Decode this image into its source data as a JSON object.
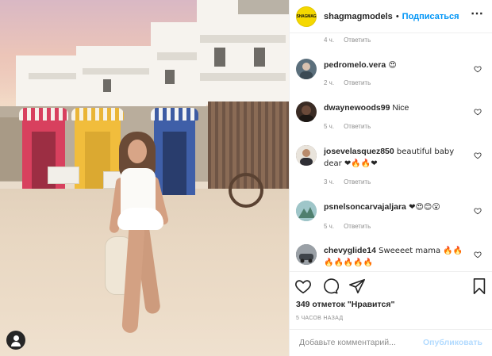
{
  "post": {
    "author": {
      "username": "shagmagmodels",
      "avatar_text": "SHAGMAG",
      "follow_label": "Подписаться",
      "separator": "•"
    },
    "image_alt": "beach photo",
    "top_meta": {
      "time": "4 ч.",
      "reply_label": "Ответить"
    },
    "comments": [
      {
        "username": "pedromelo.vera",
        "text": " 😍",
        "time": "2 ч.",
        "reply_label": "Ответить",
        "avatar_color": "#5b6f7c"
      },
      {
        "username": "dwaynewoods99",
        "text": " Nice",
        "time": "5 ч.",
        "reply_label": "Ответить",
        "avatar_color": "#3a2b24"
      },
      {
        "username": "josevelasquez850",
        "text": " beautiful baby dear ❤🔥🔥❤",
        "time": "3 ч.",
        "reply_label": "Ответить",
        "avatar_color": "#6e5a4e"
      },
      {
        "username": "psnelsoncarvajaljara",
        "text": " ❤😍😊😮",
        "time": "5 ч.",
        "reply_label": "Ответить",
        "avatar_color": "#7aa7b0"
      },
      {
        "username": "chevyglide14",
        "text": " Sweeeet mama 🔥🔥🔥🔥🔥🔥🔥",
        "time": "",
        "reply_label": "",
        "avatar_color": "#4b4f55"
      }
    ],
    "likes_text": "349 отметок \"Нравится\"",
    "timestamp": "5 ЧАСОВ НАЗАД",
    "add_comment_placeholder": "Добавьте комментарий...",
    "publish_label": "Опубликовать",
    "icons": [
      "heart-icon",
      "comment-icon",
      "share-icon",
      "bookmark-icon",
      "more-icon",
      "user-tag-icon"
    ],
    "colors": {
      "accent": "#0095f6",
      "publish_disabled": "#b3dbff",
      "brand_yellow": "#f5d800"
    }
  }
}
